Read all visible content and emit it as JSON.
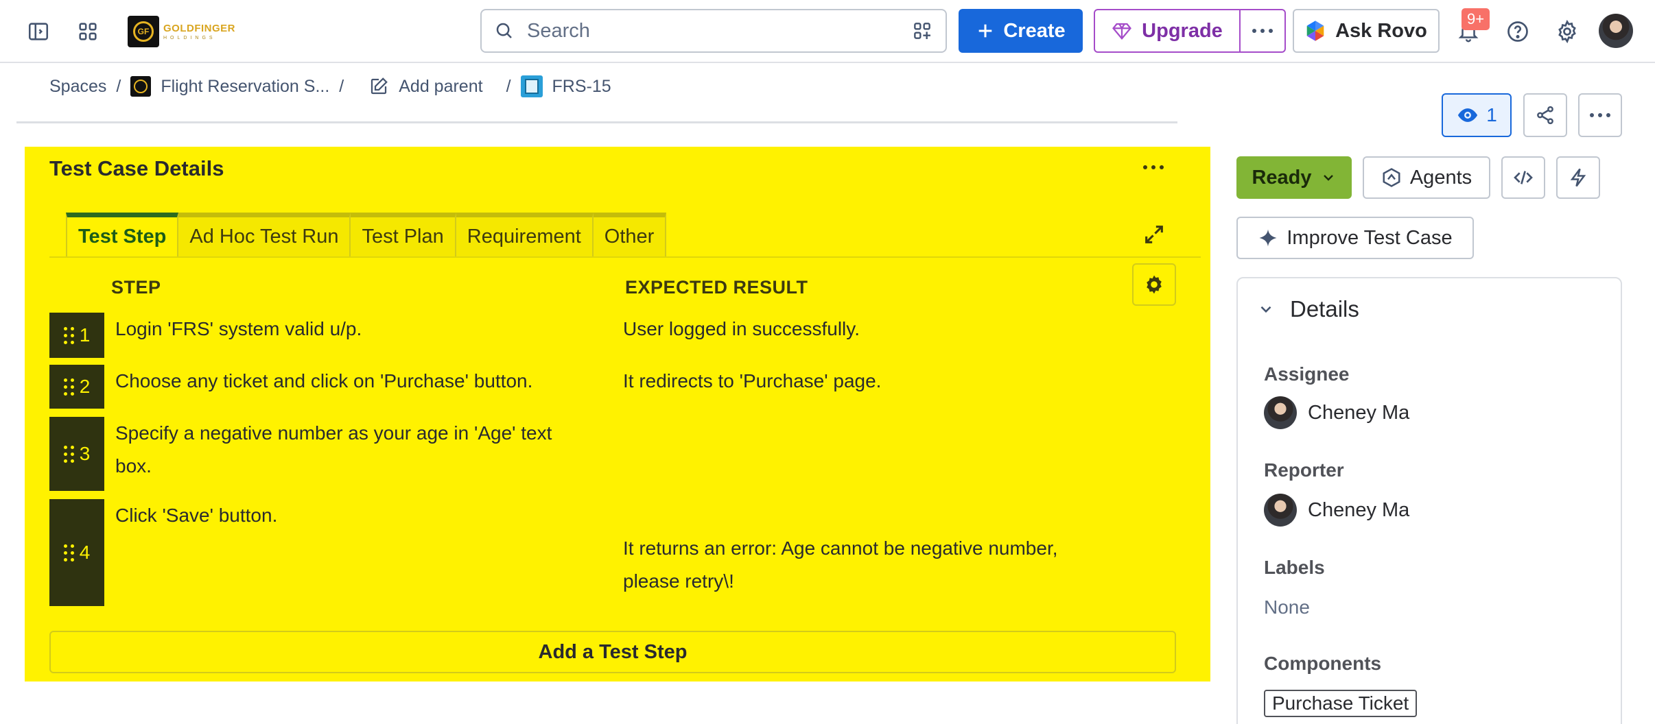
{
  "topbar": {
    "logo": {
      "text_main": "GOLDFINGER",
      "text_sub": "HOLDINGS",
      "mark": "GF"
    },
    "search": {
      "placeholder": "Search"
    },
    "create_label": "Create",
    "upgrade_label": "Upgrade",
    "rovo_label": "Ask Rovo",
    "notifications_badge": "9+"
  },
  "breadcrumb": {
    "spaces": "Spaces",
    "project": "Flight Reservation S...",
    "add_parent": "Add parent",
    "issue_key": "FRS-15",
    "separator": "/"
  },
  "actions": {
    "watch_count": "1"
  },
  "panel": {
    "title": "Test Case Details",
    "tabs": [
      {
        "label": "Test Step",
        "active": true
      },
      {
        "label": "Ad Hoc Test Run",
        "active": false
      },
      {
        "label": "Test Plan",
        "active": false
      },
      {
        "label": "Requirement",
        "active": false
      },
      {
        "label": "Other",
        "active": false
      }
    ],
    "columns": {
      "step": "STEP",
      "expected": "EXPECTED RESULT"
    },
    "rows": [
      {
        "num": "1",
        "step": "Login 'FRS' system valid u/p.",
        "expected": "User logged in successfully."
      },
      {
        "num": "2",
        "step": "Choose any ticket and click on 'Purchase' button.",
        "expected": "It redirects to 'Purchase' page."
      },
      {
        "num": "3",
        "step": "Specify a negative number as your age in 'Age' text box.",
        "expected": ""
      },
      {
        "num": "4",
        "step": "Click 'Save' button.",
        "expected": "It returns an error: Age cannot be negative number, please retry\\!"
      }
    ],
    "add_step_label": "Add a Test Step"
  },
  "sidebar": {
    "status": "Ready",
    "agents_label": "Agents",
    "improve_label": "Improve Test Case",
    "details": {
      "title": "Details",
      "assignee_label": "Assignee",
      "assignee": "Cheney Ma",
      "reporter_label": "Reporter",
      "reporter": "Cheney Ma",
      "labels_label": "Labels",
      "labels_value": "None",
      "components_label": "Components",
      "component": "Purchase Ticket"
    }
  },
  "colors": {
    "panel_bg": "#fff200",
    "primary": "#1868db",
    "upgrade": "#a54cc9",
    "status_ready": "#82b536",
    "step_num_bg": "#2f3310"
  }
}
